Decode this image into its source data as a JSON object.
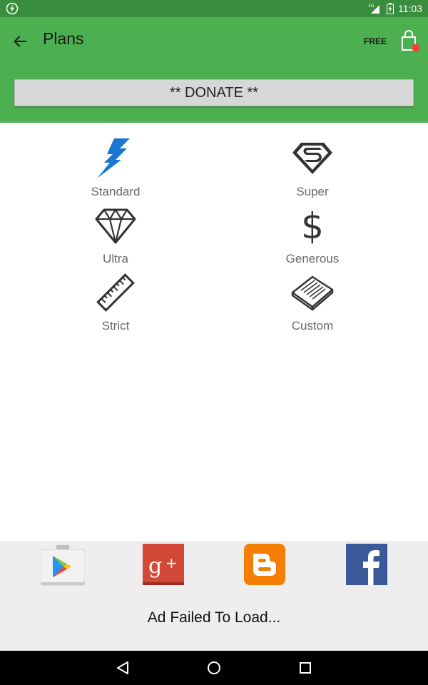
{
  "status_bar": {
    "time": "11:03",
    "network": "3G",
    "icons": [
      "app-bolt-icon",
      "signal-icon",
      "battery-icon"
    ]
  },
  "header": {
    "title": "Plans",
    "plan_tier": "FREE",
    "donate_label": "** DONATE **",
    "colors": {
      "status_bar": "#388e3c",
      "toolbar": "#4caf50",
      "cart_badge": "#f44336"
    }
  },
  "plans": [
    {
      "label": "Standard",
      "icon": "lightning-bolt-icon",
      "color": "#1976d2"
    },
    {
      "label": "Super",
      "icon": "superman-shield-icon",
      "color": "#333333"
    },
    {
      "label": "Ultra",
      "icon": "diamond-icon",
      "color": "#333333"
    },
    {
      "label": "Generous",
      "icon": "dollar-icon",
      "color": "#333333"
    },
    {
      "label": "Strict",
      "icon": "ruler-icon",
      "color": "#333333"
    },
    {
      "label": "Custom",
      "icon": "notepad-icon",
      "color": "#333333"
    }
  ],
  "footer": {
    "links": [
      "play-store-icon",
      "google-plus-icon",
      "blogger-icon",
      "facebook-icon"
    ],
    "ad_status": "Ad Failed To Load..."
  },
  "nav_bar": {
    "buttons": [
      "back-triangle-icon",
      "home-circle-icon",
      "recents-square-icon"
    ]
  }
}
